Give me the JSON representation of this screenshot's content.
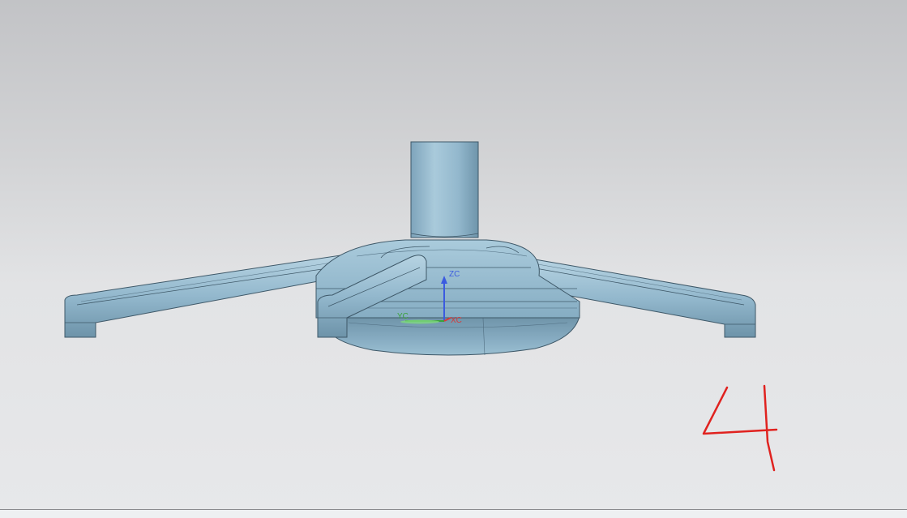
{
  "viewport": {
    "triad": {
      "z_label": "ZC",
      "y_label": "YC",
      "x_label": "XC",
      "z_color": "#3b5be0",
      "y_color": "#3aa33a",
      "x_color": "#d83a3a"
    },
    "model_color": "#8fb6cd",
    "annotation_color": "#e0221f"
  }
}
